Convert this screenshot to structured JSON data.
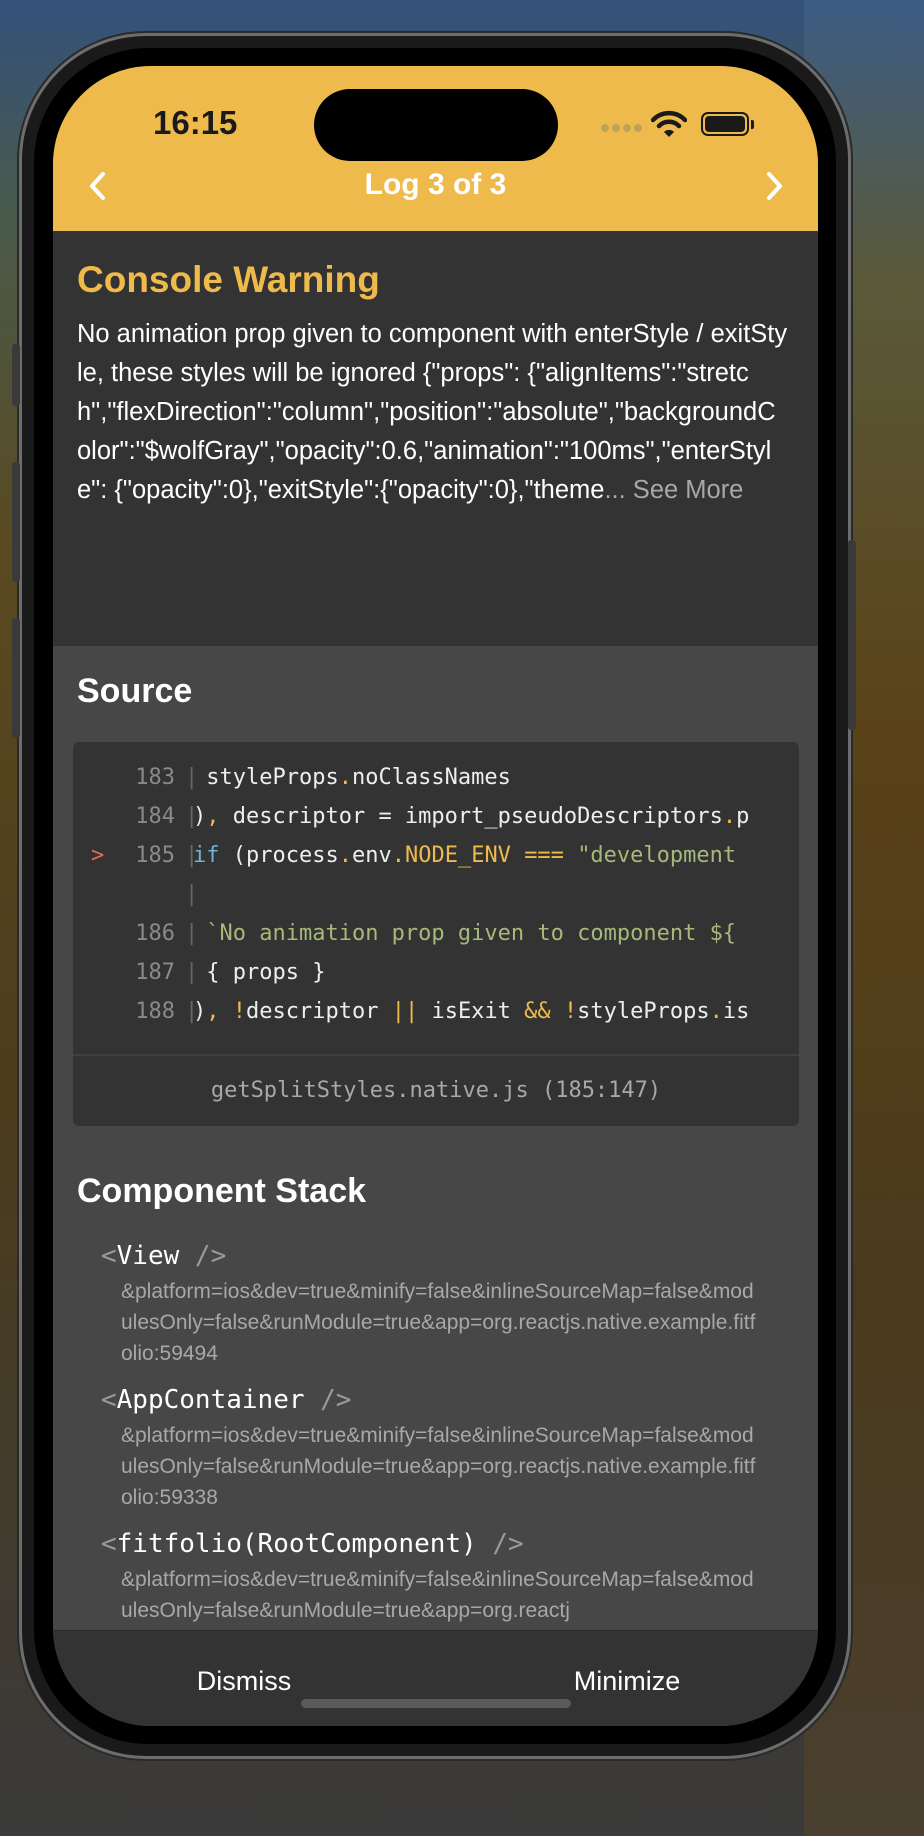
{
  "status_bar": {
    "time": "16:15"
  },
  "nav": {
    "prev_label": "‹",
    "title": "Log 3 of 3",
    "next_label": "›"
  },
  "warning": {
    "title": "Console Warning",
    "body": "No animation prop given to component   with enterStyle / exitStyle, these styles will be ignored {\"props\": {\"alignItems\":\"stretch\",\"flexDirection\":\"column\",\"position\":\"absolute\",\"backgroundColor\":\"$wolfGray\",\"opacity\":0.6,\"animation\":\"100ms\",\"enterStyle\": {\"opacity\":0},\"exitStyle\":{\"opacity\":0},\"theme",
    "see_more": "... See More"
  },
  "source": {
    "title": "Source",
    "lines": [
      {
        "marker": "",
        "num": "183",
        "code": " styleProps.noClassNames"
      },
      {
        "marker": "",
        "num": "184",
        "code": "), descriptor = import_pseudoDescriptors.p"
      },
      {
        "marker": ">",
        "num": "185",
        "code": "if (process.env.NODE_ENV === \"development"
      },
      {
        "marker": "",
        "num": "",
        "code": ""
      },
      {
        "marker": "",
        "num": "186",
        "code": " `No animation prop given to component ${"
      },
      {
        "marker": "",
        "num": "187",
        "code": " { props }"
      },
      {
        "marker": "",
        "num": "188",
        "code": "), !descriptor || isExit && !styleProps.is"
      }
    ],
    "file": "getSplitStyles.native.js (185:147)"
  },
  "component_stack": {
    "title": "Component Stack",
    "items": [
      {
        "open": "<",
        "name": "View",
        "close": " />",
        "location": "&platform=ios&dev=true&minify=false&inlineSourceMap=false&modulesOnly=false&runModule=true&app=org.reactjs.native.example.fitfolio:59494"
      },
      {
        "open": "<",
        "name": "AppContainer",
        "close": " />",
        "location": "&platform=ios&dev=true&minify=false&inlineSourceMap=false&modulesOnly=false&runModule=true&app=org.reactjs.native.example.fitfolio:59338"
      },
      {
        "open": "<",
        "name": "fitfolio(RootComponent)",
        "close": " />",
        "location": "&platform=ios&dev=true&minify=false&inlineSourceMap=false&modulesOnly=false&runModule=true&app=org.reactj"
      }
    ]
  },
  "footer": {
    "dismiss_label": "Dismiss",
    "minimize_label": "Minimize"
  },
  "colors": {
    "accent": "#efba4c",
    "panel": "#333333",
    "background": "#474747"
  }
}
